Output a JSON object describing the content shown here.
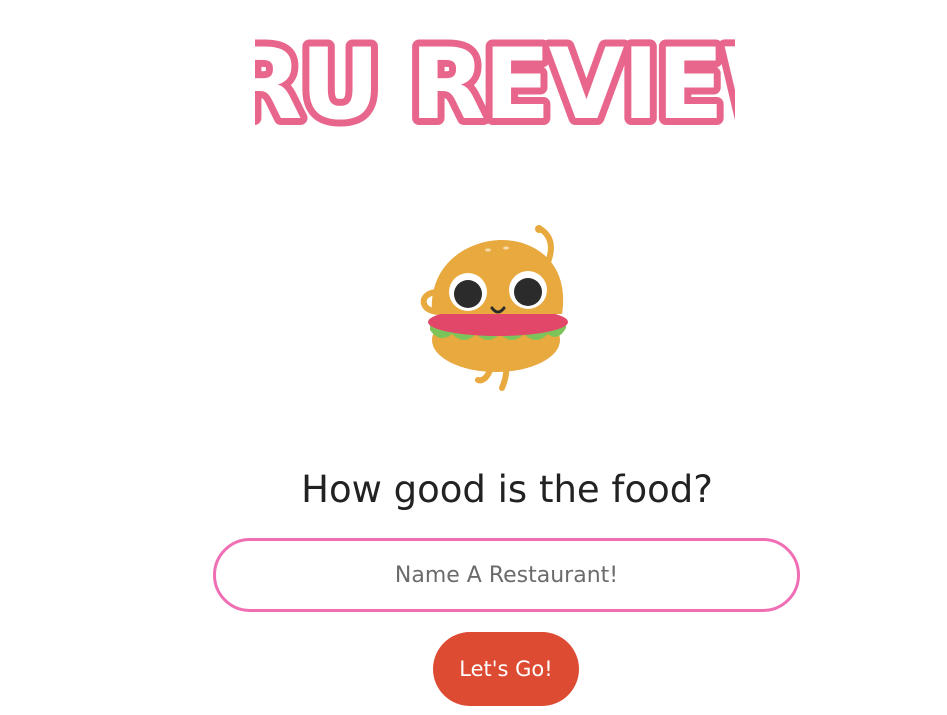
{
  "logo": {
    "text": "TRU REVIEW",
    "fill_color": "#ffffff",
    "outline_color": "#e8668b"
  },
  "mascot": {
    "icon": "burger-mascot-icon"
  },
  "search": {
    "heading": "How good is the food?",
    "placeholder": "Name A Restaurant!",
    "value": "",
    "border_color": "#f06fb4"
  },
  "submit": {
    "label": "Let's Go!",
    "color": "#dd4b32"
  }
}
